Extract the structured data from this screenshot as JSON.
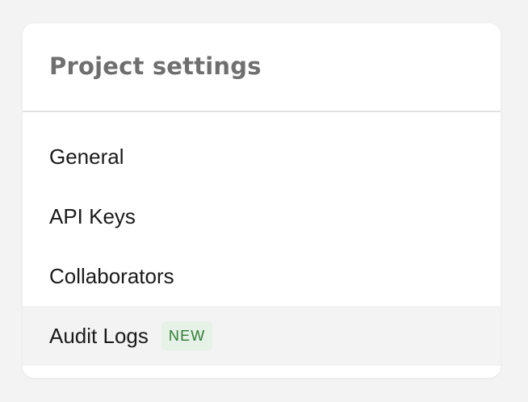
{
  "panel": {
    "title": "Project settings"
  },
  "menu": {
    "items": [
      {
        "label": "General"
      },
      {
        "label": "API Keys"
      },
      {
        "label": "Collaborators"
      },
      {
        "label": "Audit Logs",
        "badge": "NEW"
      }
    ]
  },
  "colors": {
    "badge_background": "#e6f1e7",
    "badge_text": "#2e7d32",
    "active_row": "#f3f3f3"
  }
}
